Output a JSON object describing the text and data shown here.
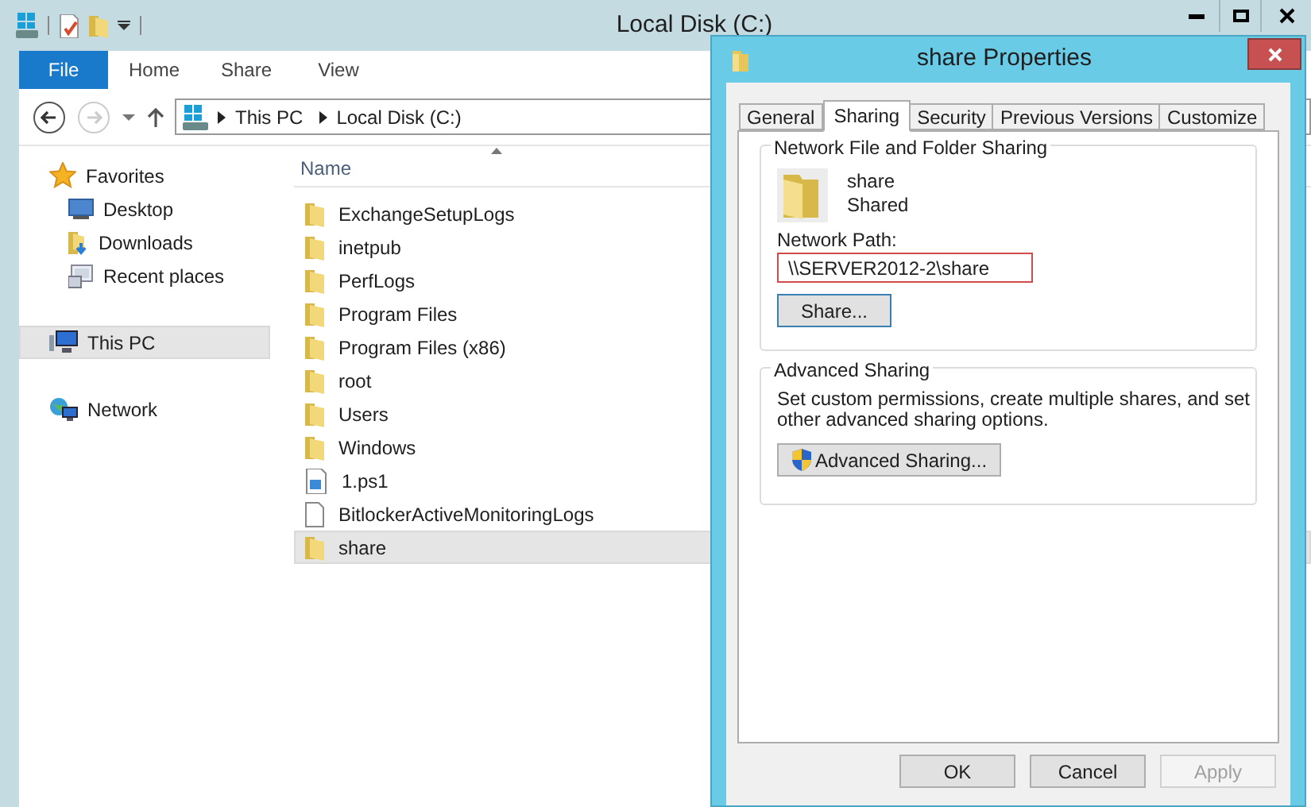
{
  "explorer": {
    "title": "Local Disk (C:)",
    "ribbon_tabs": [
      {
        "label": "File",
        "selected": true
      },
      {
        "label": "Home",
        "selected": false
      },
      {
        "label": "Share",
        "selected": false
      },
      {
        "label": "View",
        "selected": false
      }
    ],
    "breadcrumb": [
      "This PC",
      "Local Disk (C:)"
    ],
    "nav": [
      {
        "label": "Favorites",
        "kind": "favorites",
        "selected": false,
        "children": [
          {
            "label": "Desktop",
            "kind": "desktop",
            "selected": false
          },
          {
            "label": "Downloads",
            "kind": "downloads",
            "selected": false
          },
          {
            "label": "Recent places",
            "kind": "recent",
            "selected": false
          }
        ]
      },
      {
        "label": "This PC",
        "kind": "pc",
        "selected": true
      },
      {
        "label": "Network",
        "kind": "network",
        "selected": false
      }
    ],
    "column": "Name",
    "files": [
      {
        "name": "ExchangeSetupLogs",
        "kind": "folder",
        "selected": false
      },
      {
        "name": "inetpub",
        "kind": "folder",
        "selected": false
      },
      {
        "name": "PerfLogs",
        "kind": "folder",
        "selected": false
      },
      {
        "name": "Program Files",
        "kind": "folder",
        "selected": false
      },
      {
        "name": "Program Files (x86)",
        "kind": "folder",
        "selected": false
      },
      {
        "name": "root",
        "kind": "folder",
        "selected": false
      },
      {
        "name": "Users",
        "kind": "folder",
        "selected": false
      },
      {
        "name": "Windows",
        "kind": "folder",
        "selected": false
      },
      {
        "name": "1.ps1",
        "kind": "script",
        "selected": false
      },
      {
        "name": "BitlockerActiveMonitoringLogs",
        "kind": "file",
        "selected": false
      },
      {
        "name": "share",
        "kind": "folder",
        "selected": true
      }
    ]
  },
  "dialog": {
    "title": "share Properties",
    "tabs": [
      {
        "label": "General",
        "selected": false
      },
      {
        "label": "Sharing",
        "selected": true
      },
      {
        "label": "Security",
        "selected": false
      },
      {
        "label": "Previous Versions",
        "selected": false
      },
      {
        "label": "Customize",
        "selected": false
      }
    ],
    "network_group": {
      "title": "Network File and Folder Sharing",
      "folder_name": "share",
      "folder_status": "Shared",
      "path_label": "Network Path:",
      "path": "\\\\SERVER2012-2\\share",
      "button": {
        "label": "Share...",
        "focused": true
      }
    },
    "advanced_group": {
      "title": "Advanced Sharing",
      "description": "Set custom permissions, create multiple shares, and set other advanced sharing options.",
      "button": {
        "label": "Advanced Sharing...",
        "focused": false
      }
    },
    "buttons": [
      {
        "label": "OK",
        "disabled": false
      },
      {
        "label": "Cancel",
        "disabled": false
      },
      {
        "label": "Apply",
        "disabled": true
      }
    ]
  }
}
